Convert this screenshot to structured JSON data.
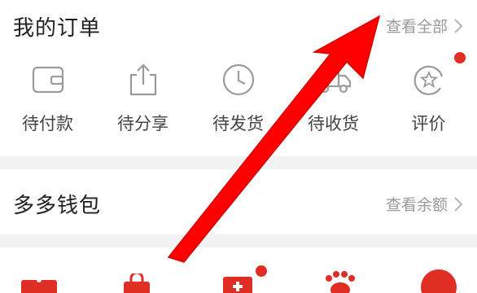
{
  "orders": {
    "title": "我的订单",
    "view_all": "查看全部",
    "items": [
      {
        "label": "待付款"
      },
      {
        "label": "待分享"
      },
      {
        "label": "待发货"
      },
      {
        "label": "待收货"
      },
      {
        "label": "评价"
      }
    ]
  },
  "wallet": {
    "title": "多多钱包",
    "view_balance": "查看余额"
  },
  "colors": {
    "accent": "#e02e24",
    "arrow": "#ff0000",
    "icon_gray": "#9b9b9b",
    "divider": "#f2f2f2"
  }
}
